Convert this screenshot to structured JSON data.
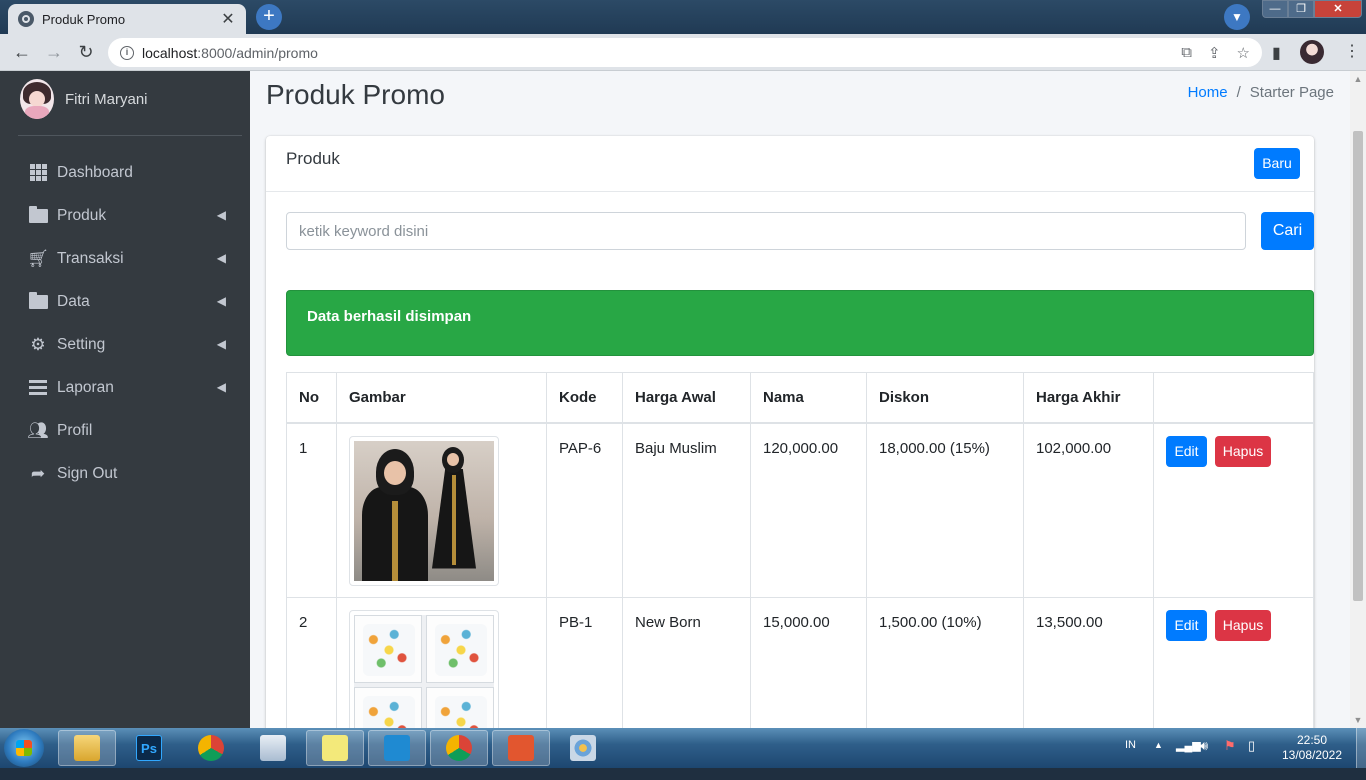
{
  "browser": {
    "tab_title": "Produk Promo",
    "tab_close": "✕",
    "new_tab": "+",
    "url_host": "localhost",
    "url_rest": ":8000/admin/promo",
    "colors": {
      "chrome_bg": "#dfe3e8",
      "accent": "#3d78c2"
    }
  },
  "sidebar": {
    "user_name": "Fitri Maryani",
    "items": [
      {
        "label": "Dashboard",
        "icon": "grid-icon",
        "has_submenu": false
      },
      {
        "label": "Produk",
        "icon": "folder-open-icon",
        "has_submenu": true
      },
      {
        "label": "Transaksi",
        "icon": "shopping-cart-icon",
        "has_submenu": true
      },
      {
        "label": "Data",
        "icon": "folder-icon",
        "has_submenu": true
      },
      {
        "label": "Setting",
        "icon": "gears-icon",
        "has_submenu": true
      },
      {
        "label": "Laporan",
        "icon": "list-icon",
        "has_submenu": true
      },
      {
        "label": "Profil",
        "icon": "users-icon",
        "has_submenu": false
      },
      {
        "label": "Sign Out",
        "icon": "sign-out-icon",
        "has_submenu": false
      }
    ],
    "colors": {
      "bg": "#343a40",
      "text": "#c2c7d0"
    }
  },
  "header": {
    "page_title": "Produk Promo",
    "breadcrumb": {
      "home": "Home",
      "separator": "/",
      "current": "Starter Page"
    }
  },
  "card": {
    "title": "Produk",
    "new_button": "Baru",
    "search_placeholder": "ketik keyword disini",
    "search_button": "Cari",
    "alert": "Data berhasil disimpan"
  },
  "table": {
    "headers": [
      "No",
      "Gambar",
      "Kode",
      "Harga Awal",
      "Nama",
      "Diskon",
      "Harga Akhir",
      ""
    ],
    "rows": [
      {
        "no": "1",
        "image": "product-photo-baju-muslim",
        "kode": "PAP-6",
        "harga_awal": "Baju Muslim",
        "nama": "120,000.00",
        "diskon": "18,000.00 (15%)",
        "harga_akhir": "102,000.00"
      },
      {
        "no": "2",
        "image": "product-photo-new-born",
        "kode": "PB-1",
        "harga_awal": "New Born",
        "nama": "15,000.00",
        "diskon": "1,500.00 (10%)",
        "harga_akhir": "13,500.00"
      }
    ],
    "edit_label": "Edit",
    "delete_label": "Hapus"
  },
  "colors": {
    "primary": "#007bff",
    "danger": "#dc3545",
    "success": "#28a745"
  },
  "taskbar": {
    "apps": [
      "explorer-icon",
      "photoshop-icon",
      "chrome-icon",
      "keyboard-icon",
      "sticky-notes-icon",
      "vscode-icon",
      "chrome-icon",
      "screencast-icon",
      "paint-icon"
    ],
    "photoshop_label": "Ps",
    "language": "IN",
    "time": "22:50",
    "date": "13/08/2022"
  }
}
